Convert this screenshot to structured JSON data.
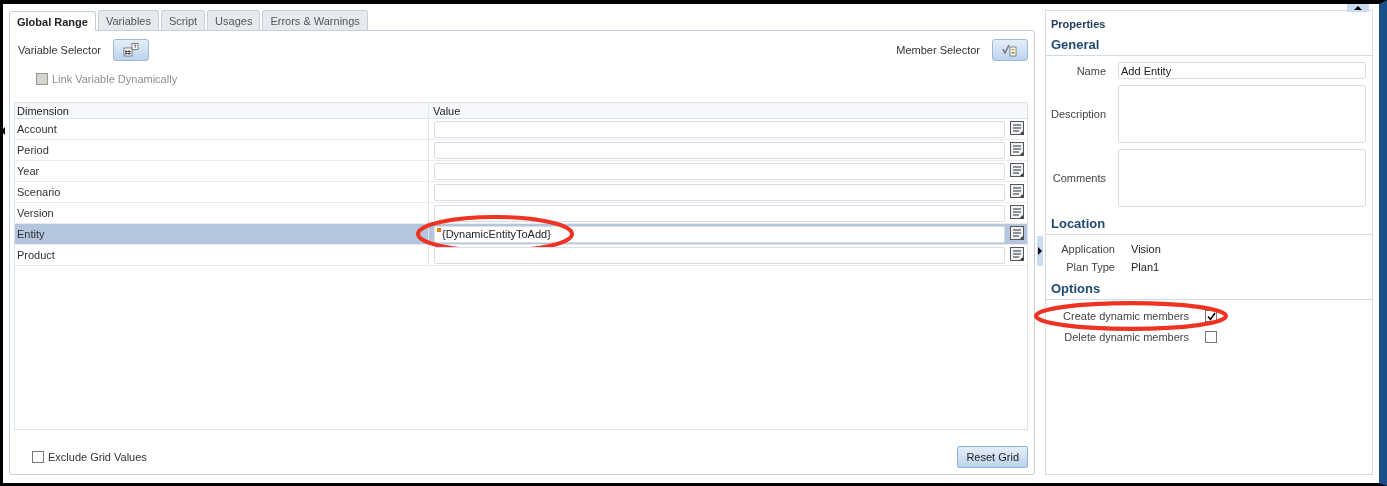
{
  "tabs": [
    {
      "label": "Global Range",
      "selected": true
    },
    {
      "label": "Variables",
      "selected": false
    },
    {
      "label": "Script",
      "selected": false
    },
    {
      "label": "Usages",
      "selected": false
    },
    {
      "label": "Errors & Warnings",
      "selected": false
    }
  ],
  "variable_selector": {
    "label": "Variable Selector"
  },
  "member_selector": {
    "label": "Member Selector"
  },
  "link_variable": {
    "label": "Link Variable Dynamically",
    "checked": false,
    "disabled": true
  },
  "grid": {
    "columns": [
      "Dimension",
      "Value"
    ],
    "rows": [
      {
        "dimension": "Account",
        "selected": false,
        "marked": false,
        "highlighted": false
      },
      {
        "dimension": "Period",
        "selected": false,
        "marked": false,
        "highlighted": false
      },
      {
        "dimension": "Year",
        "selected": false,
        "marked": false,
        "highlighted": false
      },
      {
        "dimension": "Scenario",
        "selected": false,
        "marked": false,
        "highlighted": false
      },
      {
        "dimension": "Version",
        "selected": false,
        "marked": false,
        "highlighted": false
      },
      {
        "dimension": "Entity",
        "value": "{DynamicEntityToAdd}",
        "selected": true,
        "marked": true,
        "highlighted": true
      },
      {
        "dimension": "Product",
        "selected": false,
        "marked": false,
        "highlighted": false
      }
    ]
  },
  "exclude_grid_values": {
    "label": "Exclude Grid Values",
    "checked": false
  },
  "reset_button": {
    "label": "Reset Grid"
  },
  "properties": {
    "title": "Properties",
    "general": {
      "title": "General",
      "fields": [
        {
          "label": "Name",
          "value": "Add Entity",
          "kind": "input"
        },
        {
          "label": "Description",
          "kind": "area"
        },
        {
          "label": "Comments",
          "kind": "area"
        }
      ]
    },
    "location": {
      "title": "Location",
      "items": [
        {
          "label": "Application",
          "value": "Vision"
        },
        {
          "label": "Plan Type",
          "value": "Plan1"
        }
      ]
    },
    "options": {
      "title": "Options",
      "items": [
        {
          "label": "Create dynamic members",
          "checked": true,
          "highlighted": true
        },
        {
          "label": "Delete dynamic members",
          "checked": false,
          "highlighted": false
        }
      ]
    }
  }
}
